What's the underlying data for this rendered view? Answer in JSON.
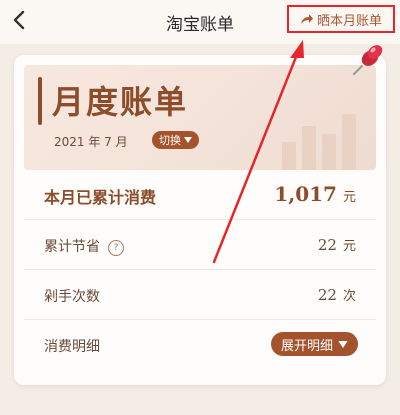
{
  "nav": {
    "title": "淘宝账单",
    "share_label": "晒本月账单"
  },
  "hero": {
    "title": "月度账单",
    "date": "2021 年 7 月",
    "switch_label": "切换"
  },
  "rows": [
    {
      "label": "本月已累计消费",
      "value": "1,017",
      "unit": "元"
    },
    {
      "label": "累计节省",
      "value": "22",
      "unit": "元"
    },
    {
      "label": "剁手次数",
      "value": "22",
      "unit": "次"
    },
    {
      "label": "消费明细",
      "action": "展开明细"
    }
  ],
  "colors": {
    "brand_brown": "#8c4d2b",
    "pill_brown": "#a4532d",
    "annotation_red": "#e6262a"
  }
}
